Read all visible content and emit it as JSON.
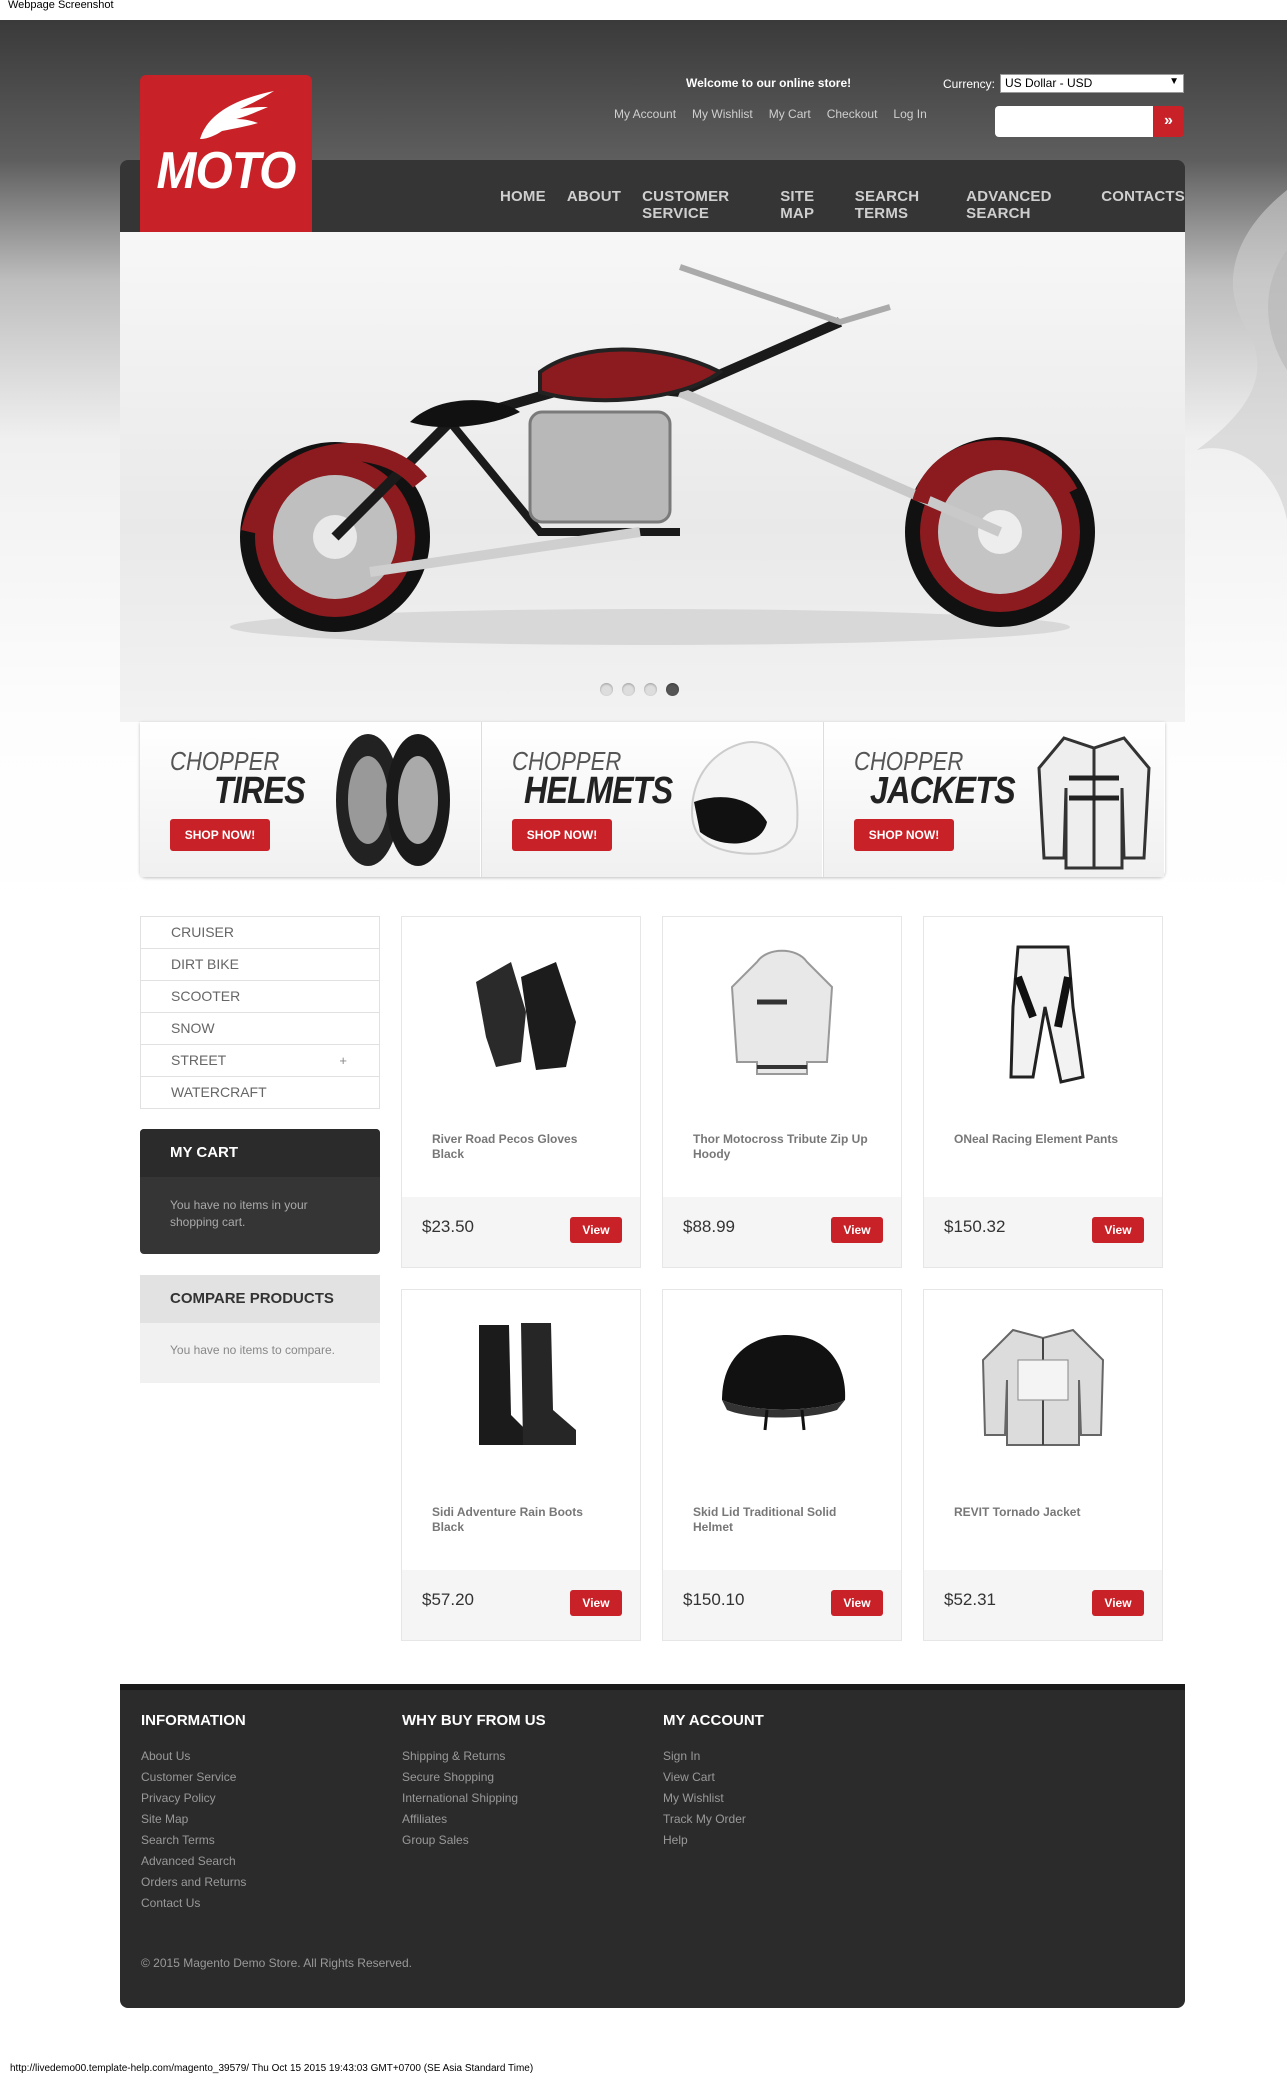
{
  "screenshot_title": "Webpage Screenshot",
  "footer_url": "http://livedemo00.template-help.com/magento_39579/ Thu Oct 15 2015 19:43:03 GMT+0700 (SE Asia Standard Time)",
  "logo": {
    "text": "MOTO"
  },
  "header": {
    "welcome": "Welcome to our online store!",
    "links": [
      "My Account",
      "My Wishlist",
      "My Cart",
      "Checkout",
      "Log In"
    ],
    "currency_label": "Currency:",
    "currency_value": "US Dollar - USD",
    "search_button": "»"
  },
  "nav": [
    "HOME",
    "ABOUT",
    "CUSTOMER SERVICE",
    "SITE MAP",
    "SEARCH TERMS",
    "ADVANCED SEARCH",
    "CONTACTS"
  ],
  "slider": {
    "dots": 4,
    "active": 3
  },
  "banners": [
    {
      "small": "CHOPPER",
      "big": "TIRES",
      "button": "SHOP NOW!"
    },
    {
      "small": "CHOPPER",
      "big": "HELMETS",
      "button": "SHOP NOW!"
    },
    {
      "small": "CHOPPER",
      "big": "JACKETS",
      "button": "SHOP NOW!"
    }
  ],
  "categories": [
    {
      "label": "CRUISER",
      "expand": ""
    },
    {
      "label": "DIRT BIKE",
      "expand": ""
    },
    {
      "label": "SCOOTER",
      "expand": ""
    },
    {
      "label": "SNOW",
      "expand": ""
    },
    {
      "label": "STREET",
      "expand": "+"
    },
    {
      "label": "WATERCRAFT",
      "expand": ""
    }
  ],
  "cart": {
    "title": "MY CART",
    "text": "You have no items in your shopping cart."
  },
  "compare": {
    "title": "COMPARE PRODUCTS",
    "text": "You have no items to compare."
  },
  "products": [
    {
      "name": "River Road Pecos Gloves Black",
      "price": "$23.50",
      "button": "View",
      "icon": "gloves"
    },
    {
      "name": "Thor Motocross Tribute Zip Up Hoody",
      "price": "$88.99",
      "button": "View",
      "icon": "hoody"
    },
    {
      "name": "ONeal Racing Element Pants",
      "price": "$150.32",
      "button": "View",
      "icon": "pants"
    },
    {
      "name": "Sidi Adventure Rain Boots Black",
      "price": "$57.20",
      "button": "View",
      "icon": "boots"
    },
    {
      "name": "Skid Lid Traditional Solid Helmet",
      "price": "$150.10",
      "button": "View",
      "icon": "helmet"
    },
    {
      "name": "REVIT Tornado Jacket",
      "price": "$52.31",
      "button": "View",
      "icon": "jacket"
    }
  ],
  "footer": {
    "columns": [
      {
        "title": "INFORMATION",
        "links": [
          "About Us",
          "Customer Service",
          "Privacy Policy",
          "Site Map",
          "Search Terms",
          "Advanced Search",
          "Orders and Returns",
          "Contact Us"
        ]
      },
      {
        "title": "WHY BUY FROM US",
        "links": [
          "Shipping & Returns",
          "Secure Shopping",
          "International Shipping",
          "Affiliates",
          "Group Sales"
        ]
      },
      {
        "title": "MY ACCOUNT",
        "links": [
          "Sign In",
          "View Cart",
          "My Wishlist",
          "Track My Order",
          "Help"
        ]
      }
    ],
    "copyright": "© 2015 Magento Demo Store. All Rights Reserved."
  },
  "colors": {
    "accent": "#c82127",
    "nav_bg": "#353535",
    "footer_bg": "#2b2b2b"
  }
}
